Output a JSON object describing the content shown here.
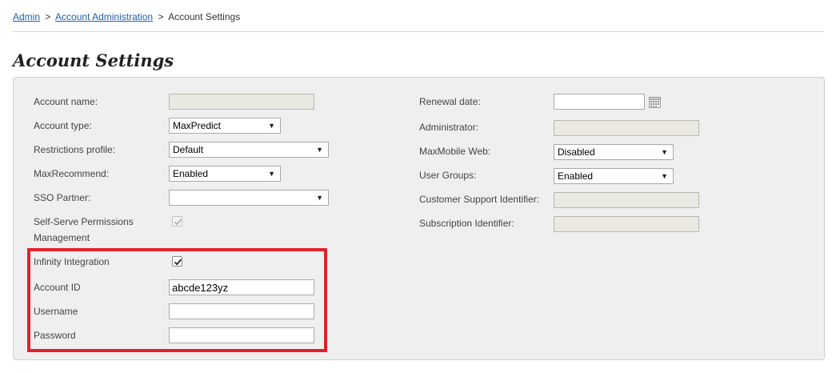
{
  "breadcrumb": {
    "admin": "Admin",
    "sep1": ">",
    "account_admin": "Account Administration",
    "sep2": ">",
    "current": "Account Settings"
  },
  "page_title": "Account Settings",
  "left": {
    "account_name": {
      "label": "Account name:",
      "value": ""
    },
    "account_type": {
      "label": "Account type:",
      "value": "MaxPredict"
    },
    "restrictions_profile": {
      "label": "Restrictions profile:",
      "value": "Default"
    },
    "maxrecommend": {
      "label": "MaxRecommend:",
      "value": "Enabled"
    },
    "sso_partner": {
      "label": "SSO Partner:",
      "value": ""
    },
    "self_serve": {
      "label_line1": "Self-Serve Permissions",
      "label_line2": "Management",
      "checked": true
    },
    "infinity_integration": {
      "label": "Infinity Integration",
      "checked": true
    },
    "account_id": {
      "label": "Account ID",
      "value": "abcde123yz"
    },
    "username": {
      "label": "Username",
      "value": ""
    },
    "password": {
      "label": "Password",
      "value": ""
    }
  },
  "right": {
    "renewal_date": {
      "label": "Renewal date:",
      "value": ""
    },
    "administrator": {
      "label": "Administrator:",
      "value": ""
    },
    "maxmobile_web": {
      "label": "MaxMobile Web:",
      "value": "Disabled"
    },
    "user_groups": {
      "label": "User Groups:",
      "value": "Enabled"
    },
    "customer_support_id": {
      "label": "Customer Support Identifier:",
      "value": ""
    },
    "subscription_id": {
      "label": "Subscription Identifier:",
      "value": ""
    }
  },
  "icons": {
    "dropdown": "chevron-down-icon",
    "calendar": "calendar-icon",
    "checkbox": "checkmark-icon"
  },
  "colors": {
    "link": "#1f5fa8",
    "highlight": "#e3202b",
    "panel_bg": "#efefef",
    "readonly_bg": "#e9e9e2"
  }
}
